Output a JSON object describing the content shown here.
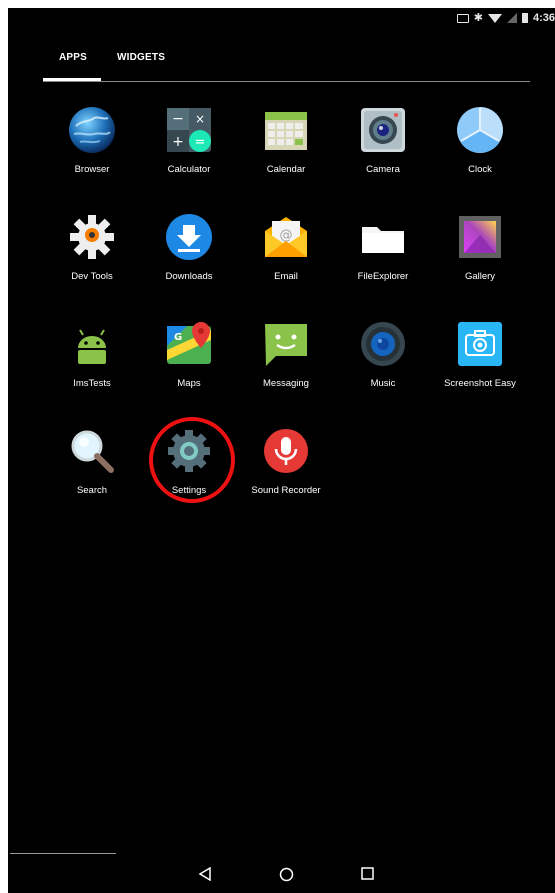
{
  "status_bar": {
    "time": "4:36",
    "icons": [
      "cast-icon",
      "bluetooth-icon",
      "wifi-icon",
      "signal-icon",
      "battery-icon"
    ]
  },
  "tabs": [
    {
      "label": "APPS",
      "selected": true
    },
    {
      "label": "WIDGETS",
      "selected": false
    }
  ],
  "apps": [
    {
      "label": "Browser",
      "icon": "browser-globe-icon"
    },
    {
      "label": "Calculator",
      "icon": "calculator-icon"
    },
    {
      "label": "Calendar",
      "icon": "calendar-icon"
    },
    {
      "label": "Camera",
      "icon": "camera-icon"
    },
    {
      "label": "Clock",
      "icon": "clock-icon"
    },
    {
      "label": "Dev Tools",
      "icon": "dev-tools-gear-icon"
    },
    {
      "label": "Downloads",
      "icon": "download-icon"
    },
    {
      "label": "Email",
      "icon": "email-envelope-icon"
    },
    {
      "label": "FileExplorer",
      "icon": "folder-icon"
    },
    {
      "label": "Gallery",
      "icon": "gallery-icon"
    },
    {
      "label": "ImsTests",
      "icon": "android-robot-icon"
    },
    {
      "label": "Maps",
      "icon": "maps-icon"
    },
    {
      "label": "Messaging",
      "icon": "messaging-icon"
    },
    {
      "label": "Music",
      "icon": "music-speaker-icon"
    },
    {
      "label": "Screenshot Easy",
      "icon": "screenshot-camera-icon"
    },
    {
      "label": "Search",
      "icon": "magnifier-icon"
    },
    {
      "label": "Settings",
      "icon": "settings-gear-icon",
      "highlighted": true
    },
    {
      "label": "Sound Recorder",
      "icon": "microphone-icon"
    }
  ],
  "colors": {
    "background": "#000000",
    "highlight_ring": "#ee1111",
    "label_text": "#ffffff"
  },
  "nav_bar": {
    "buttons": [
      "back-icon",
      "home-icon",
      "recents-icon"
    ]
  }
}
